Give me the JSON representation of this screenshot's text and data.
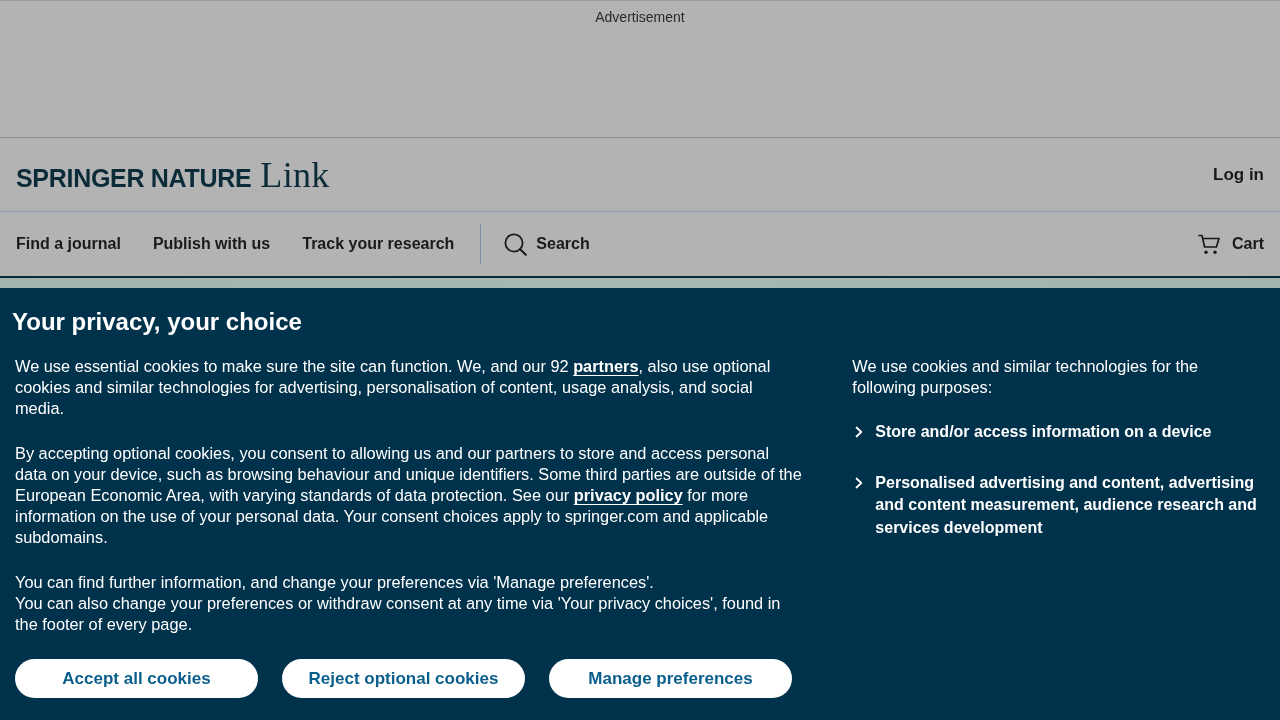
{
  "advertisement": {
    "label": "Advertisement"
  },
  "header": {
    "logo": {
      "wordmark": "SPRINGER NATURE",
      "product": "Link"
    },
    "login": "Log in"
  },
  "nav": {
    "links": [
      "Find a journal",
      "Publish with us",
      "Track your research"
    ],
    "search": "Search",
    "cart": "Cart"
  },
  "cookie_banner": {
    "title": "Your privacy, your choice",
    "paragraphs": [
      {
        "lines": [
          [
            {
              "kind": "text",
              "text": "We use essential cookies to make sure the site can function. We, and our 92 "
            },
            {
              "kind": "link",
              "text": "partners"
            },
            {
              "kind": "text",
              "text": ", also use optional cookies and similar technologies for advertising, personalisation of content, usage analysis, and social media."
            }
          ]
        ]
      },
      {
        "lines": [
          [
            {
              "kind": "text",
              "text": "By accepting optional cookies, you consent to allowing us and our partners to store and access personal data on your device, such as browsing behaviour and unique identifiers. Some third parties are outside of the European Economic Area, with varying standards of data protection. See our "
            },
            {
              "kind": "link",
              "text": "privacy policy"
            },
            {
              "kind": "text",
              "text": " for more information on the use of your personal data. Your consent choices apply to springer.com and applicable subdomains."
            }
          ]
        ]
      },
      {
        "lines": [
          [
            {
              "kind": "text",
              "text": "You can find further information, and change your preferences via 'Manage preferences'."
            }
          ],
          [
            {
              "kind": "text",
              "text": "You can also change your preferences or withdraw consent at any time via 'Your privacy choices', found in the footer of every page."
            }
          ]
        ]
      }
    ],
    "purposes_intro": "We use cookies and similar technologies for the following purposes:",
    "purposes": [
      {
        "label": "Store and/or access information on a device",
        "expanded": false
      },
      {
        "label": "Personalised advertising and content, advertising and content measurement, audience research and services development",
        "expanded": false
      }
    ],
    "buttons": [
      "Accept all cookies",
      "Reject optional cookies",
      "Manage preferences"
    ]
  }
}
